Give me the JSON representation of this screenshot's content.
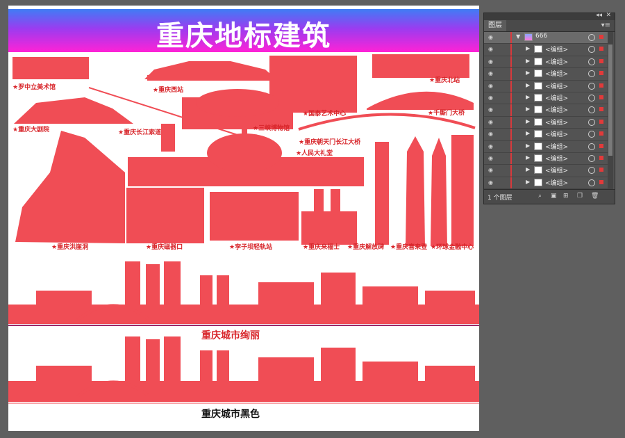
{
  "artboard": {
    "title": "重庆地标建筑",
    "landmarks": [
      "★罗中立美术馆",
      "★重庆西站",
      "★重庆北站",
      "★重庆大剧院",
      "★重庆长江索道",
      "★三峡博物馆",
      "★国泰艺术中心",
      "★千厮门大桥",
      "★重庆朝天门长江大桥",
      "★人民大礼堂",
      "★重庆洪崖洞",
      "★重庆磁器口",
      "★李子坝轻轨站",
      "★重庆来福士",
      "★重庆解放碑",
      "★重庆喜来登",
      "★环球金融中心"
    ],
    "caption_colorful": "重庆城市绚丽",
    "caption_black": "重庆城市黑色",
    "silhouette_color": "#f04d55",
    "banner_colors": [
      "#3f7df5",
      "#9a3cf0",
      "#ff22d6"
    ]
  },
  "layers_panel": {
    "tab": "图层",
    "top_layer": "666",
    "groups": [
      "<编组>",
      "<编组>",
      "<编组>",
      "<编组>",
      "<编组>",
      "<编组>",
      "<编组>",
      "<编组>",
      "<编组>",
      "<编组>",
      "<编组>",
      "<编组>"
    ],
    "footer_count": "1 个图层",
    "icons": [
      "eye-icon",
      "disclosure-triangle-icon",
      "target-circle-icon",
      "search-icon",
      "make-clipping-mask-icon",
      "new-sublayer-icon",
      "new-layer-icon",
      "trash-icon"
    ]
  }
}
